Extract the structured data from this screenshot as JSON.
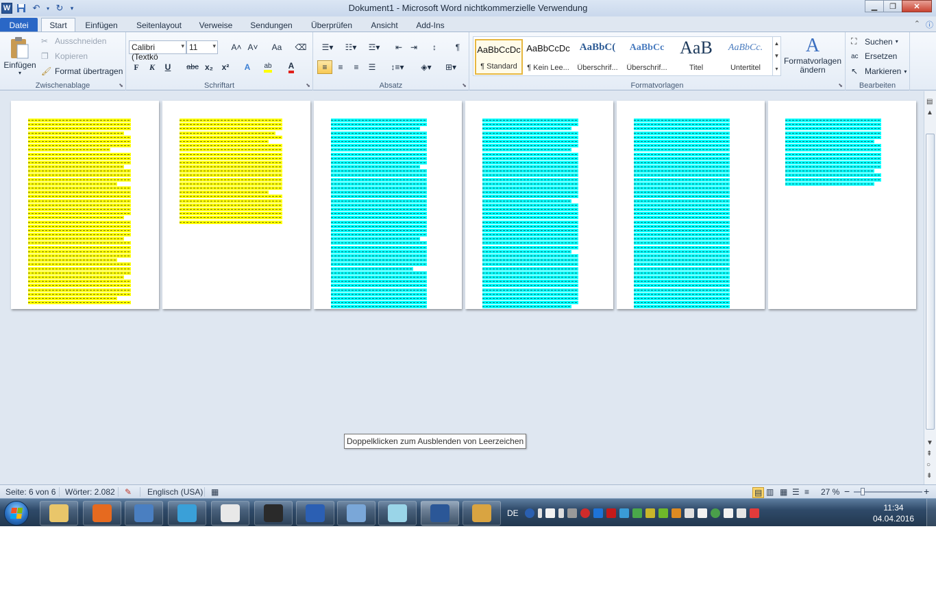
{
  "window": {
    "title": "Dokument1  -  Microsoft Word nichtkommerzielle Verwendung",
    "app_icon": "W"
  },
  "qat": {
    "icons": [
      "save-icon",
      "undo-icon",
      "redo-icon",
      "customize-icon"
    ]
  },
  "tabs": [
    {
      "label": "Datei"
    },
    {
      "label": "Start"
    },
    {
      "label": "Einfügen"
    },
    {
      "label": "Seitenlayout"
    },
    {
      "label": "Verweise"
    },
    {
      "label": "Sendungen"
    },
    {
      "label": "Überprüfen"
    },
    {
      "label": "Ansicht"
    },
    {
      "label": "Add-Ins"
    }
  ],
  "ribbon": {
    "clipboard": {
      "label": "Zwischenablage",
      "paste": "Einfügen",
      "cut": "Ausschneiden",
      "copy": "Kopieren",
      "format_painter": "Format übertragen"
    },
    "font": {
      "label": "Schriftart",
      "font_name": "Calibri (Textkö",
      "font_size": "11",
      "bold": "F",
      "italic": "K",
      "underline": "U",
      "strike": "abc",
      "subscript": "x₂",
      "superscript": "x²",
      "grow": "A˄",
      "shrink": "A˅",
      "case": "Aa"
    },
    "paragraph": {
      "label": "Absatz",
      "pilcrow": "¶"
    },
    "styles": {
      "label": "Formatvorlagen",
      "items": [
        {
          "preview": "AaBbCcDc",
          "name": "¶ Standard"
        },
        {
          "preview": "AaBbCcDc",
          "name": "¶ Kein Lee..."
        },
        {
          "preview": "AaBbC(",
          "name": "Überschrif..."
        },
        {
          "preview": "AaBbCc",
          "name": "Überschrif..."
        },
        {
          "preview": "AaB",
          "name": "Titel"
        },
        {
          "preview": "AaBbCc.",
          "name": "Untertitel"
        }
      ],
      "change_styles": "Formatvorlagen",
      "change_styles_2": "ändern"
    },
    "editing": {
      "label": "Bearbeiten",
      "find": "Suchen",
      "replace": "Ersetzen",
      "select": "Markieren"
    }
  },
  "document": {
    "tooltip": "Doppelklicken zum Ausblenden von Leerzeichen",
    "highlight_colors": {
      "yellow": "#ffff00",
      "cyan": "#00ffff"
    },
    "pages": [
      {
        "highlight": "yellow"
      },
      {
        "highlight": "yellow"
      },
      {
        "highlight": "cyan"
      },
      {
        "highlight": "cyan"
      },
      {
        "highlight": "cyan"
      },
      {
        "highlight": "cyan"
      }
    ]
  },
  "statusbar": {
    "page": "Seite: 6 von 6",
    "words": "Wörter: 2.082",
    "language": "Englisch (USA)",
    "zoom": "27 %",
    "zoom_minus": "−",
    "zoom_plus": "+"
  },
  "taskbar": {
    "apps": [
      {
        "icon": "explorer-icon",
        "color": "#e9c66a"
      },
      {
        "icon": "firefox-icon",
        "color": "#e66a1f"
      },
      {
        "icon": "thunderbird-icon",
        "color": "#4a7fc1"
      },
      {
        "icon": "quill-icon",
        "color": "#3aa0d8"
      },
      {
        "icon": "inkscape-icon",
        "color": "#e8e8e8"
      },
      {
        "icon": "headset-icon",
        "color": "#2a2a2a"
      },
      {
        "icon": "gamepad-icon",
        "color": "#2b5fb3"
      },
      {
        "icon": "keyboard-icon",
        "color": "#7aa7d8"
      },
      {
        "icon": "notepad-icon",
        "color": "#9ad5e8"
      },
      {
        "icon": "word-icon",
        "color": "#2b5797"
      },
      {
        "icon": "paint-icon",
        "color": "#d9a441"
      }
    ],
    "tray_language": "DE",
    "time": "11:34",
    "date": "04.04.2016"
  }
}
